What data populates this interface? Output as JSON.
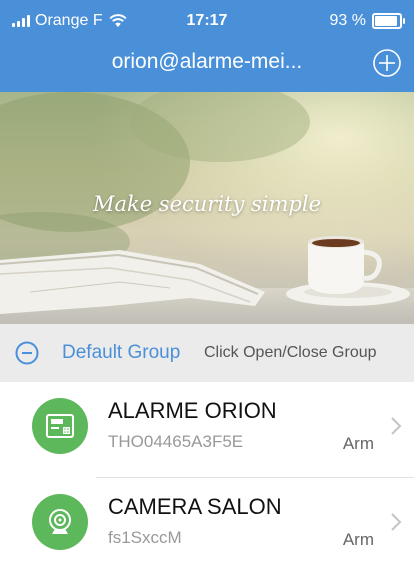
{
  "status_bar": {
    "carrier": "Orange F",
    "time": "17:17",
    "battery_text": "93 %",
    "battery_level": 0.93
  },
  "header": {
    "title": "orion@alarme-mei...",
    "add_icon": "plus-circle-icon"
  },
  "banner": {
    "tagline": "Make security simple"
  },
  "group": {
    "name": "Default Group",
    "hint": "Click Open/Close Group",
    "toggle_icon": "minus-circle-icon"
  },
  "devices": [
    {
      "name": "ALARME ORION",
      "id": "THO04465A3F5E",
      "status": "Arm",
      "icon": "alarm-panel-icon"
    },
    {
      "name": "CAMERA SALON",
      "id": "fs1SxccM",
      "status": "Arm",
      "icon": "camera-icon"
    }
  ],
  "colors": {
    "header": "#4a90d9",
    "accent": "#4a90d9",
    "device_icon_bg": "#5db85b",
    "group_bar_bg": "#ebebeb"
  }
}
